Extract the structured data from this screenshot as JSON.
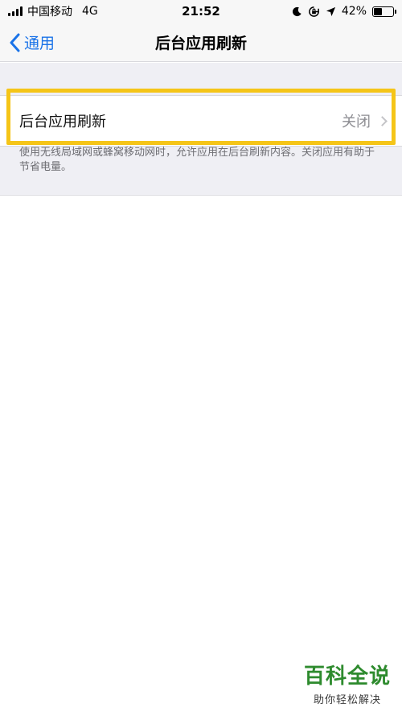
{
  "status_bar": {
    "carrier": "中国移动",
    "network": "4G",
    "time": "21:52",
    "battery_percent": "42%",
    "battery_level": 0.42,
    "icons": [
      "signal-icon",
      "moon-icon",
      "rotation-lock-icon",
      "location-icon",
      "battery-icon"
    ]
  },
  "nav": {
    "back_label": "通用",
    "title": "后台应用刷新"
  },
  "settings": {
    "row_label": "后台应用刷新",
    "row_value": "关闭",
    "footer": "使用无线局域网或蜂窝移动网时，允许应用在后台刷新内容。关闭应用有助于节省电量。"
  },
  "watermark": {
    "title": "百科全说",
    "subtitle": "助你轻松解决"
  },
  "colors": {
    "accent": "#1a73e8",
    "highlight": "#f5c518",
    "watermark": "#2e8b2e"
  }
}
